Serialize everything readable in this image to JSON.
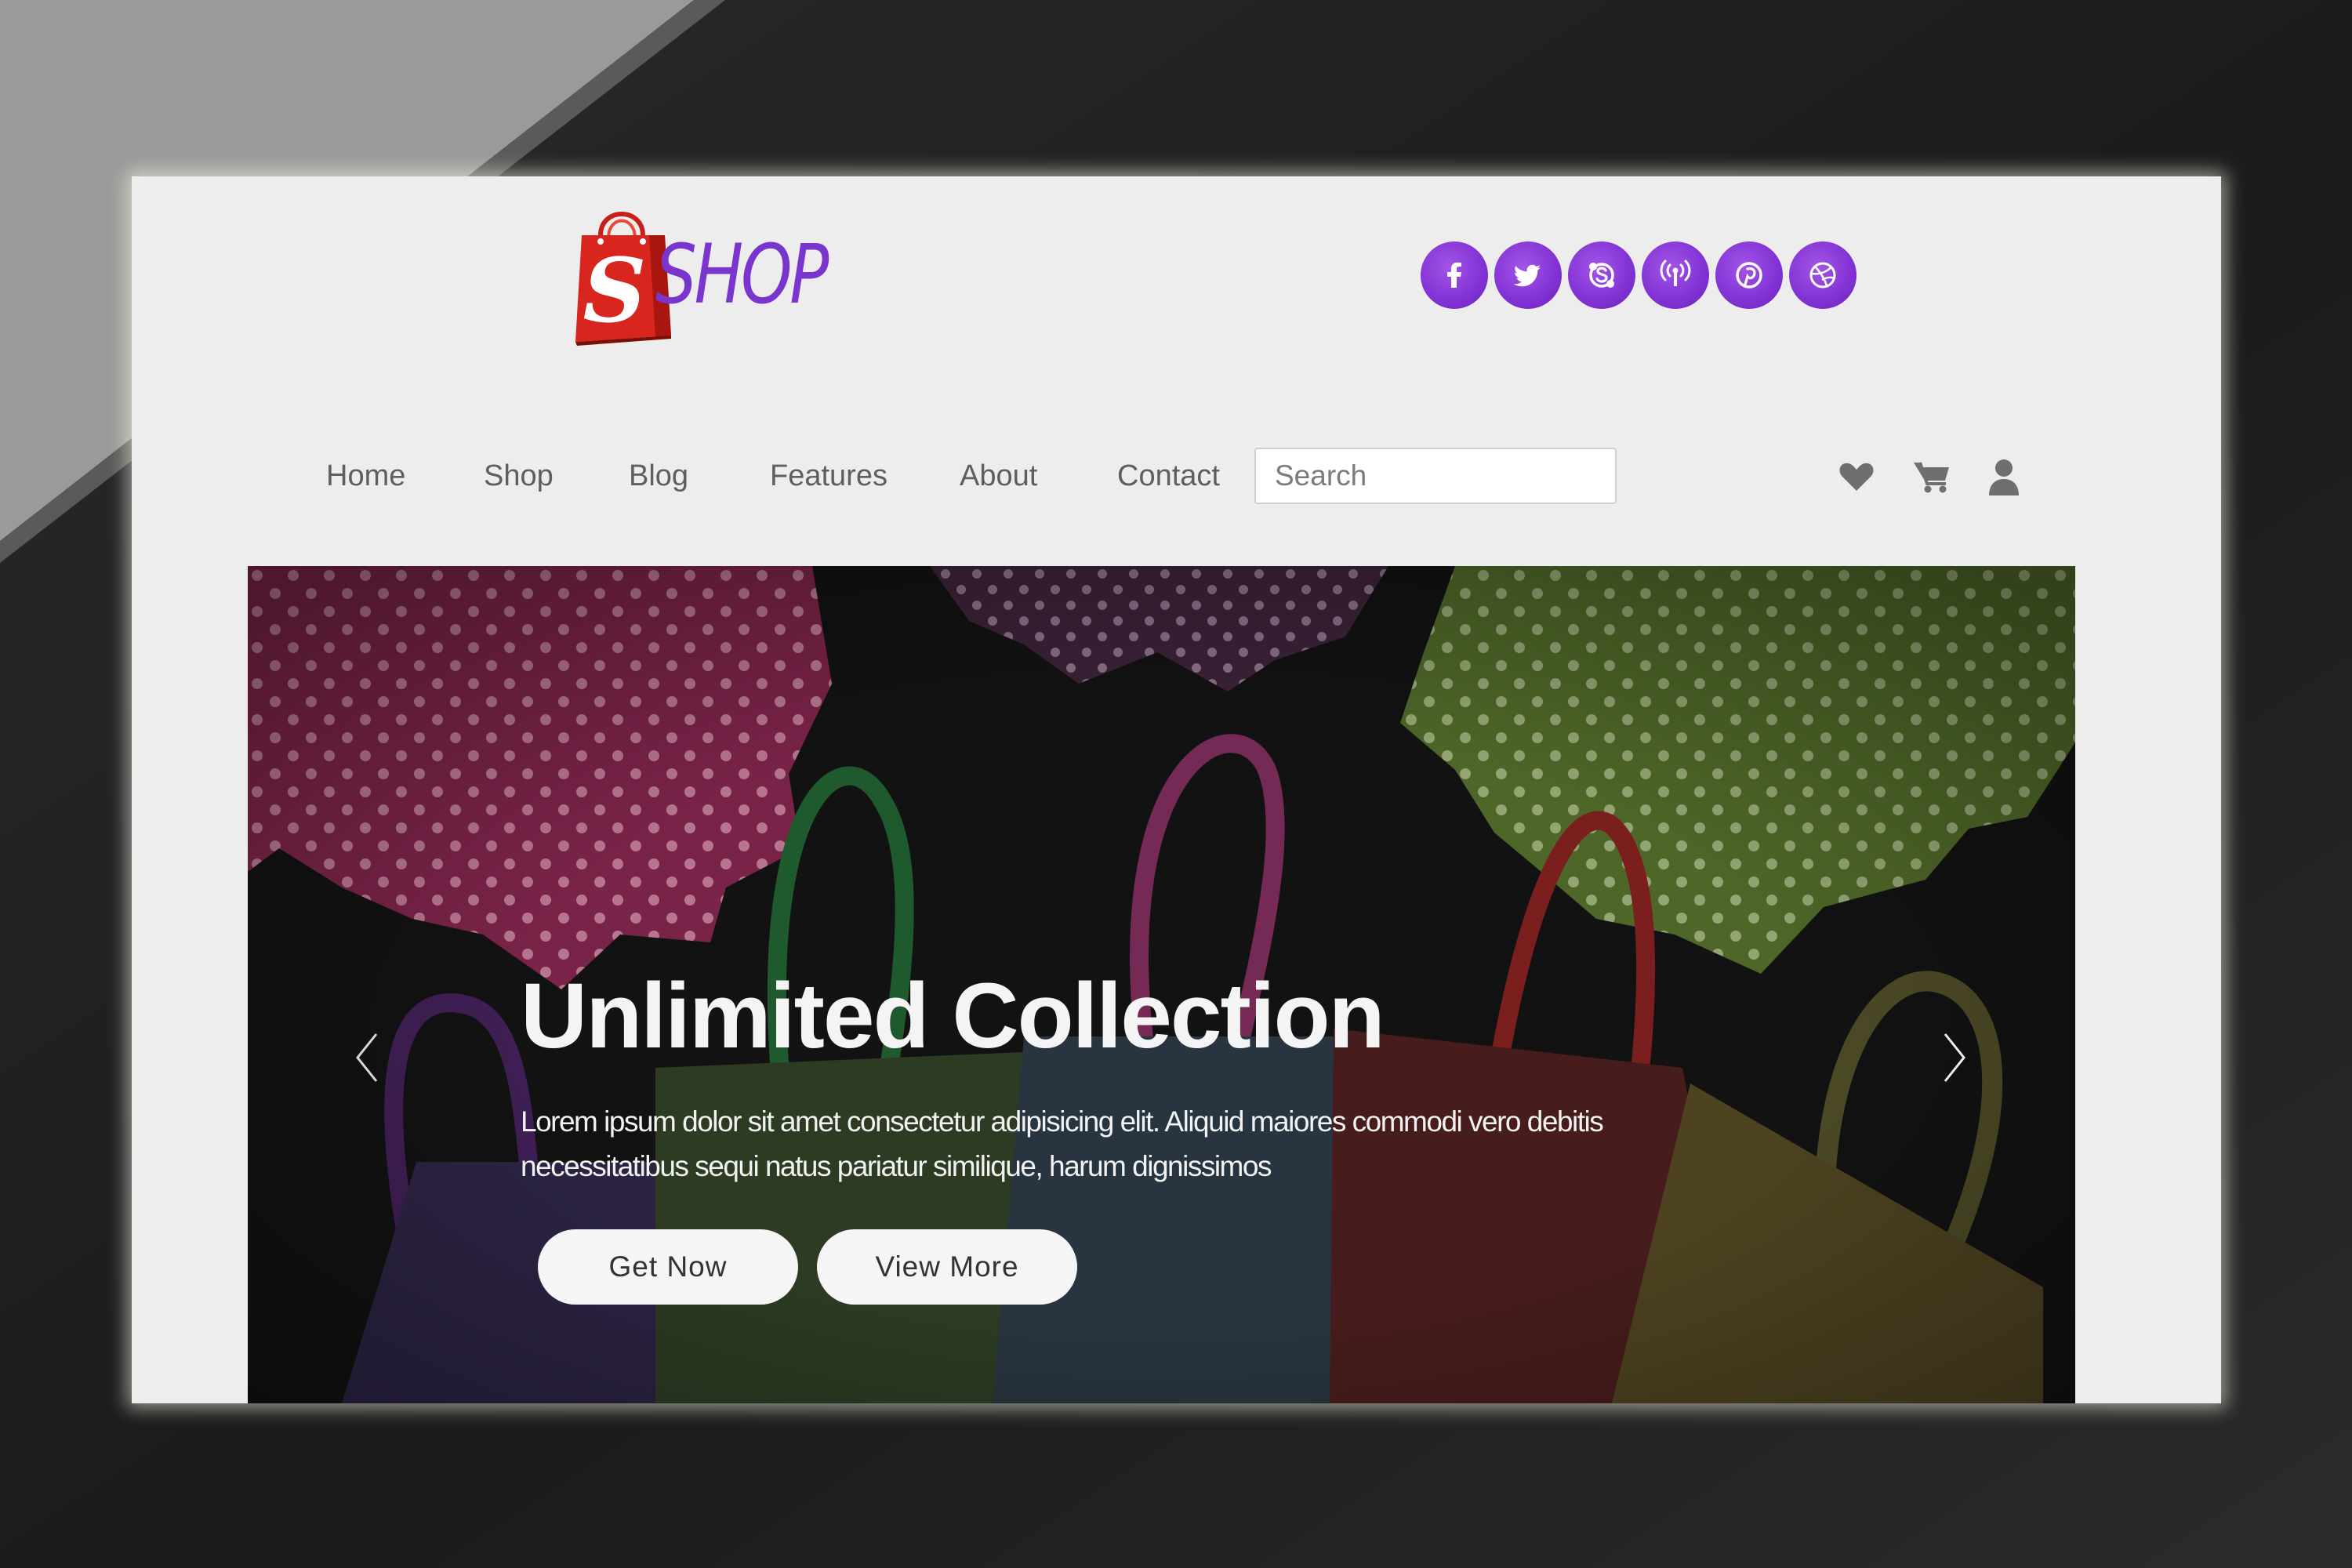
{
  "brand": {
    "logo_letter": "S",
    "name": "SHOP",
    "accent_color": "#7a35cf",
    "bag_color": "#d8261e"
  },
  "header": {
    "social_links": [
      {
        "icon": "facebook-icon"
      },
      {
        "icon": "twitter-icon"
      },
      {
        "icon": "skype-icon"
      },
      {
        "icon": "podcast-icon"
      },
      {
        "icon": "pinterest-icon"
      },
      {
        "icon": "dribbble-icon"
      }
    ]
  },
  "nav": {
    "items": [
      {
        "label": "Home"
      },
      {
        "label": "Shop"
      },
      {
        "label": "Blog"
      },
      {
        "label": "Features"
      },
      {
        "label": "About"
      },
      {
        "label": "Contact"
      }
    ],
    "search": {
      "placeholder": "Search",
      "value": ""
    },
    "utility_icons": [
      "heart-icon",
      "cart-icon",
      "user-icon"
    ]
  },
  "hero": {
    "title": "Unlimited Collection",
    "text": "Lorem ipsum dolor sit amet consectetur adipisicing elit. Aliquid maiores commodi vero debitis necessitatibus sequi natus pariatur similique, harum dignissimos",
    "primary_button": "Get Now",
    "secondary_button": "View More",
    "prev_icon": "chevron-left-icon",
    "next_icon": "chevron-right-icon"
  }
}
